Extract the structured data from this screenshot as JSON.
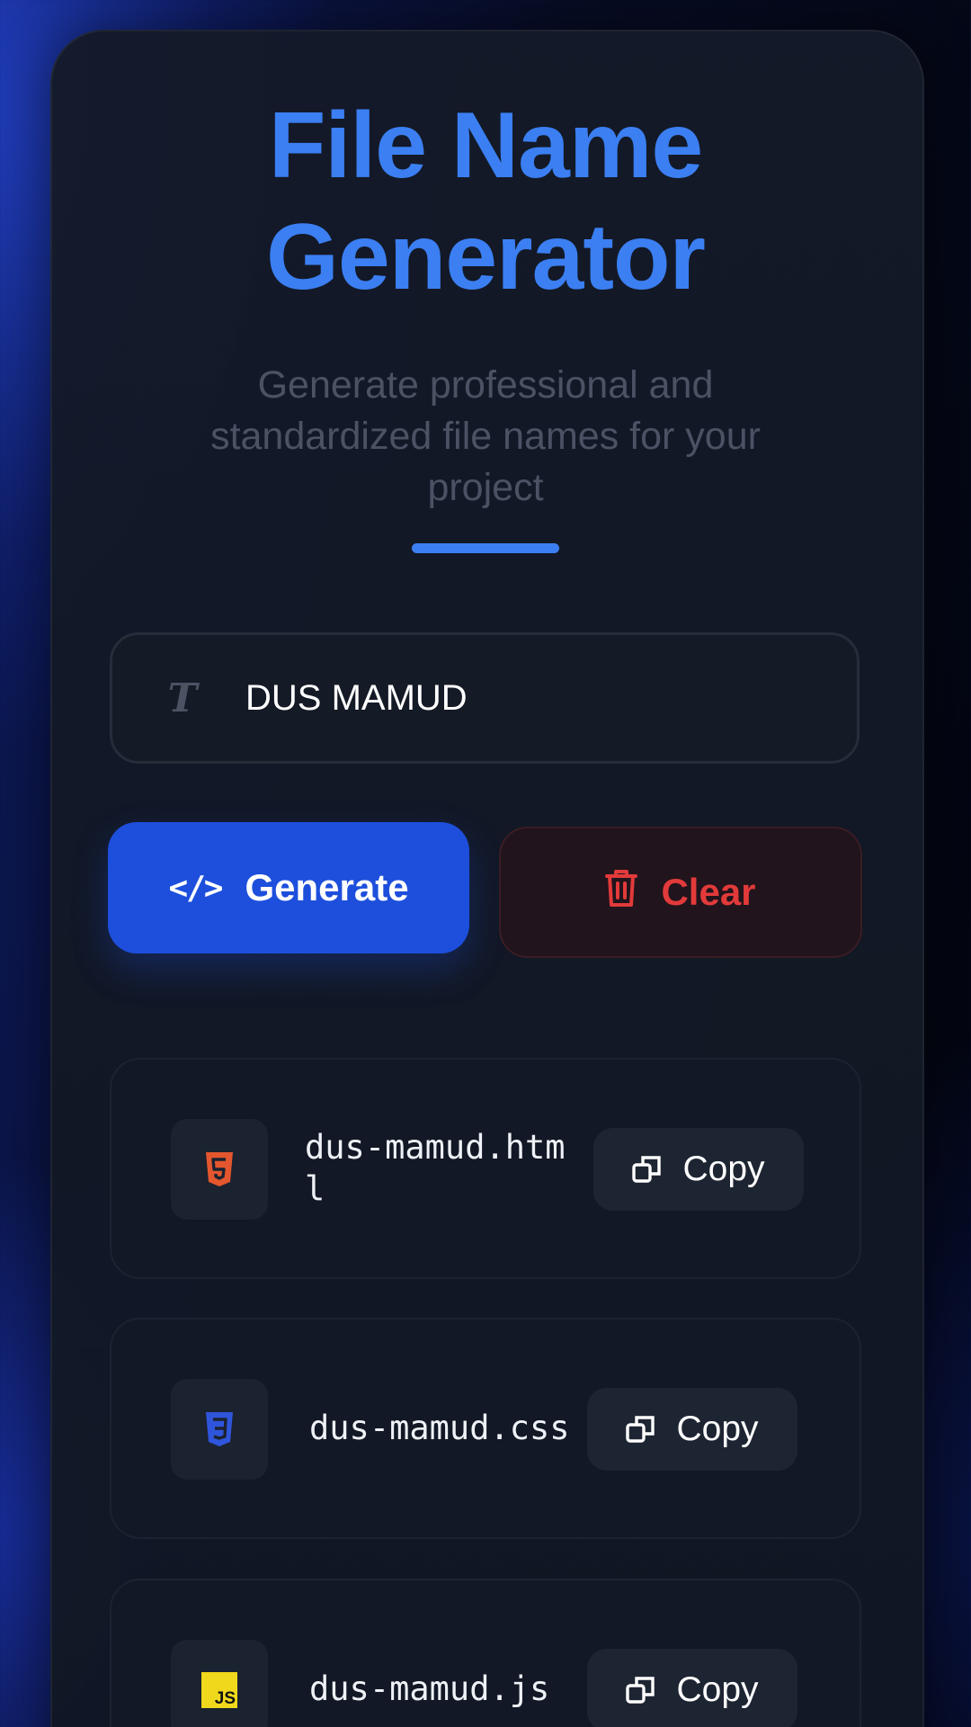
{
  "header": {
    "title_line1": "File Name",
    "title_line2": "Generator",
    "subtitle": "Generate professional and standardized file names for your project"
  },
  "input": {
    "value": "DUS MAMUD",
    "icon": "text-icon"
  },
  "actions": {
    "generate_label": "Generate",
    "generate_icon": "code-icon",
    "clear_label": "Clear",
    "clear_icon": "trash-icon"
  },
  "results": [
    {
      "file_name": "dus-mamud.html",
      "badge_icon": "html5-icon",
      "badge_color": "#e4572e",
      "copy_label": "Copy"
    },
    {
      "file_name": "dus-mamud.css",
      "badge_icon": "css3-icon",
      "badge_color": "#2f55dc",
      "copy_label": "Copy"
    },
    {
      "file_name": "dus-mamud.js",
      "badge_icon": "js-icon",
      "badge_color": "#f0d91c",
      "badge_text": "JS",
      "copy_label": "Copy"
    }
  ],
  "colors": {
    "accent": "#3b7ff2",
    "primary_button": "#1d4fdc",
    "danger": "#e23a3a",
    "card_background": "#121825"
  }
}
